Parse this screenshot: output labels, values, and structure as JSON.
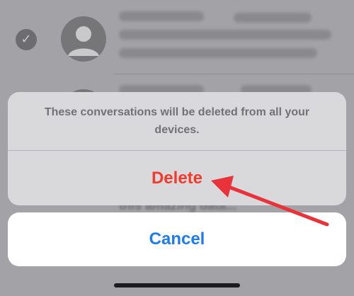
{
  "action_sheet": {
    "message": "These conversations will be deleted from all your devices.",
    "delete_label": "Delete",
    "cancel_label": "Cancel"
  },
  "background": {
    "partial_text": "this amazing data..."
  },
  "colors": {
    "destructive": "#f23b2f",
    "accent": "#1e7cf0",
    "annotation_arrow": "#e8333a"
  },
  "icons": {
    "check": "checkmark-circle-icon",
    "avatar": "person-avatar-icon"
  }
}
